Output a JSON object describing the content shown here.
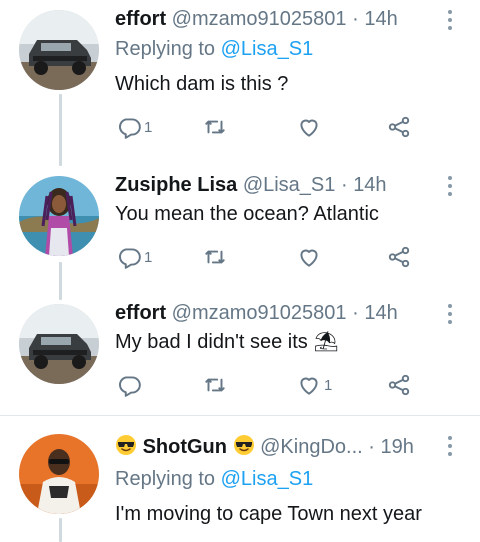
{
  "tweets": [
    {
      "name": "effort",
      "handle": "@mzamo91025801",
      "dot": "·",
      "time": "14h",
      "replying_label": "Replying to",
      "replying_to": "@Lisa_S1",
      "text": "Which dam is this ?",
      "reply_count": "1",
      "retweet_count": "",
      "like_count": ""
    },
    {
      "name": "Zusiphe Lisa",
      "handle": "@Lisa_S1",
      "dot": "·",
      "time": "14h",
      "text": "You mean the ocean? Atlantic",
      "reply_count": "1",
      "retweet_count": "",
      "like_count": ""
    },
    {
      "name": "effort",
      "handle": "@mzamo91025801",
      "dot": "·",
      "time": "14h",
      "text": "My bad I didn't see its ⛱",
      "reply_count": "",
      "retweet_count": "",
      "like_count": "1"
    },
    {
      "name": "ShotGun",
      "handle": "@KingDo...",
      "dot": "·",
      "time": "19h",
      "replying_label": "Replying to",
      "replying_to": "@Lisa_S1",
      "text": "I'm moving to cape Town next year"
    }
  ],
  "icons": {
    "reply": "reply-icon",
    "retweet": "retweet-icon",
    "like": "heart-icon",
    "share": "share-icon",
    "more": "more-vertical-icon",
    "name_emoji": "sunglasses-emoji-icon"
  },
  "colors": {
    "link": "#1da1f2",
    "muted": "#657786",
    "text": "#14171a",
    "thread_line": "#cfd9de"
  }
}
